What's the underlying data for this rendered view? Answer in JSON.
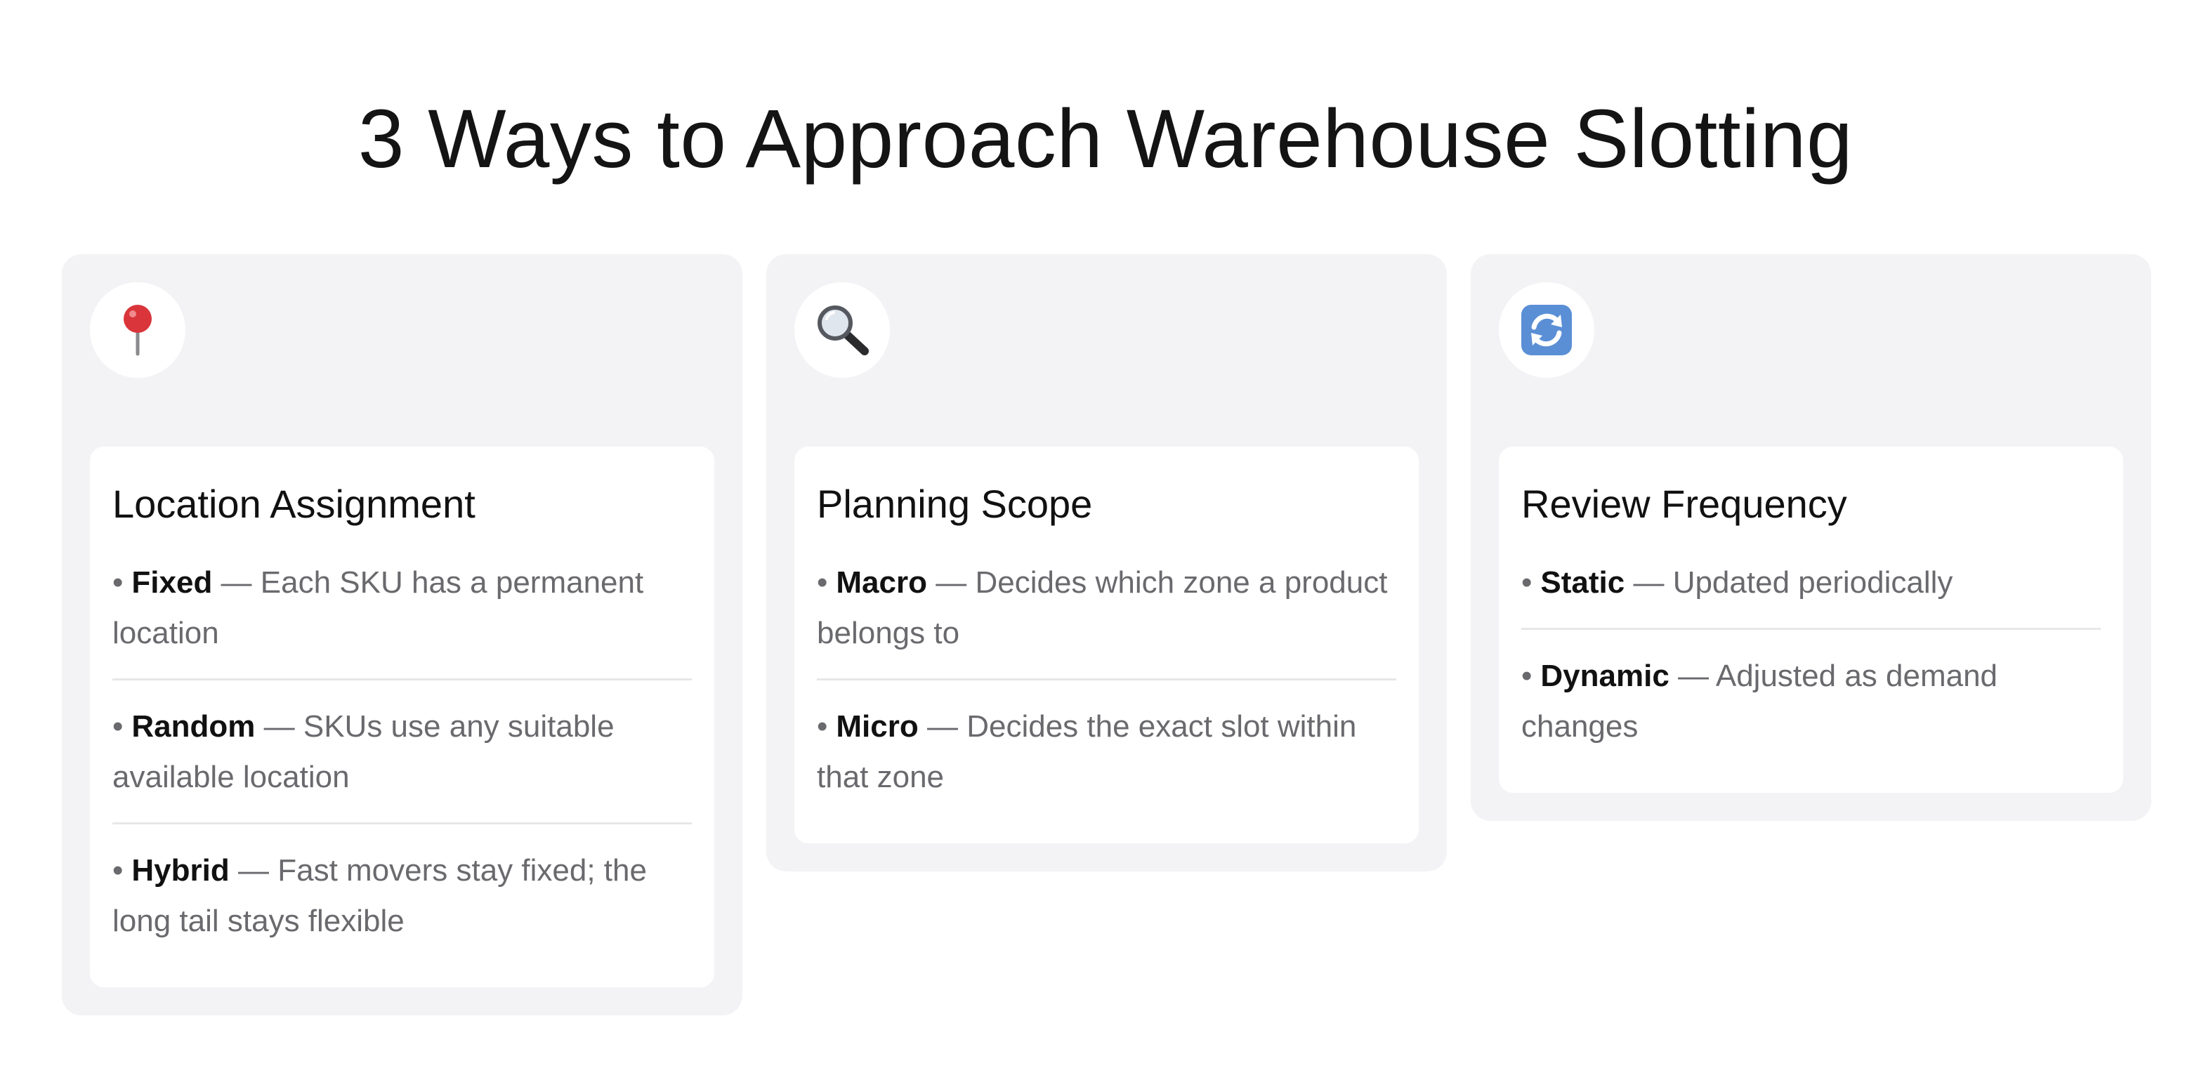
{
  "title": "3 Ways to Approach Warehouse Slotting",
  "cards": [
    {
      "icon": "round-pushpin-icon",
      "heading": "Location Assignment",
      "items": [
        {
          "bullet": "•",
          "term": "Fixed",
          "sep": " — ",
          "text": "Each SKU has a permanent location"
        },
        {
          "bullet": "•",
          "term": "Random",
          "sep": " — ",
          "text": "SKUs use any suitable available location"
        },
        {
          "bullet": "•",
          "term": "Hybrid",
          "sep": " — ",
          "text": "Fast movers stay fixed; the long tail stays flexible"
        }
      ]
    },
    {
      "icon": "magnifying-glass-icon",
      "heading": "Planning Scope",
      "items": [
        {
          "bullet": "•",
          "term": "Macro",
          "sep": " — ",
          "text": "Decides which zone a product belongs to"
        },
        {
          "bullet": "•",
          "term": "Micro",
          "sep": " — ",
          "text": "Decides the exact slot within that zone"
        }
      ]
    },
    {
      "icon": "counterclockwise-arrows-icon",
      "heading": "Review Frequency",
      "items": [
        {
          "bullet": "•",
          "term": "Static",
          "sep": " — ",
          "text": "Updated periodically"
        },
        {
          "bullet": "•",
          "term": "Dynamic",
          "sep": " — ",
          "text": "Adjusted as demand changes"
        }
      ]
    }
  ],
  "colors": {
    "card_background": "#f3f3f5",
    "inner_background": "#ffffff",
    "body_text": "#6a6a6e",
    "heading_text": "#111111",
    "pin": "#d9353b",
    "refresh_blue": "#5a8fd6"
  }
}
